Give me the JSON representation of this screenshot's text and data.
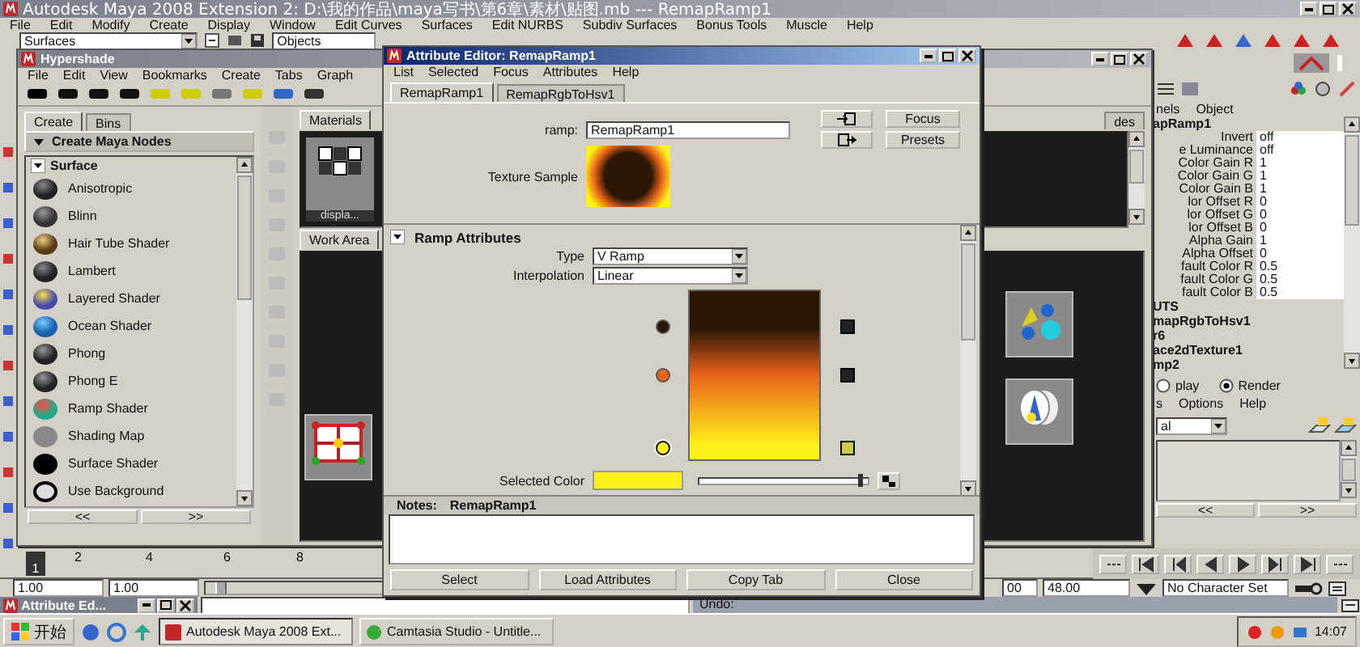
{
  "main_window": {
    "title": "Autodesk Maya 2008 Extension 2: D:\\我的作品\\maya写书\\第6章\\素材\\贴图.mb  ---  RemapRamp1",
    "menu": [
      "File",
      "Edit",
      "Modify",
      "Create",
      "Display",
      "Window",
      "Edit Curves",
      "Surfaces",
      "Edit NURBS",
      "Subdiv Surfaces",
      "Bonus Tools",
      "Muscle",
      "Help"
    ],
    "menu_set": "Surfaces",
    "select_mode": "Objects"
  },
  "hypershade": {
    "title": "Hypershade",
    "menu": [
      "File",
      "Edit",
      "View",
      "Bookmarks",
      "Create",
      "Tabs",
      "Graph"
    ],
    "create_tabs": [
      {
        "label": "Create",
        "selected": true
      },
      {
        "label": "Bins",
        "selected": false
      }
    ],
    "create_header": "Create Maya Nodes",
    "category": {
      "label": "Surface",
      "expanded": true
    },
    "nodes": [
      "Anisotropic",
      "Blinn",
      "Hair Tube Shader",
      "Lambert",
      "Layered Shader",
      "Ocean Shader",
      "Phong",
      "Phong E",
      "Ramp Shader",
      "Shading Map",
      "Surface Shader",
      "Use Background"
    ],
    "list_nav": [
      "<<",
      ">>"
    ],
    "top_tabs": [
      {
        "label": "Materials",
        "selected": true
      },
      {
        "label": "des",
        "selected": false
      }
    ],
    "material_swatch_label": "displa...",
    "work_tab": "Work Area"
  },
  "attribute_editor": {
    "title": "Attribute Editor: RemapRamp1",
    "menu": [
      "List",
      "Selected",
      "Focus",
      "Attributes",
      "Help"
    ],
    "tabs": [
      {
        "label": "RemapRamp1",
        "selected": true
      },
      {
        "label": "RemapRgbToHsv1",
        "selected": false
      }
    ],
    "node_label": "ramp:",
    "node_name": "RemapRamp1",
    "side_buttons": [
      "Focus",
      "Presets"
    ],
    "sample_label": "Texture Sample",
    "section": {
      "label": "Ramp Attributes",
      "expanded": true
    },
    "fields": [
      {
        "label": "Type",
        "value": "V Ramp"
      },
      {
        "label": "Interpolation",
        "value": "Linear"
      }
    ],
    "ramp": [
      {
        "color": "#2a1606",
        "selected": false
      },
      {
        "color": "#e8641a",
        "selected": false
      },
      {
        "color": "#fff21a",
        "selected": true
      }
    ],
    "selected_color": {
      "label": "Selected Color",
      "level": 0.97
    },
    "notes_label": "Notes:",
    "notes_node": "RemapRamp1",
    "buttons": [
      "Select",
      "Load Attributes",
      "Copy Tab",
      "Close"
    ]
  },
  "channel_box": {
    "tabs": [
      "nels",
      "Object"
    ],
    "node": "apRamp1",
    "channels": [
      {
        "label": "Invert",
        "value": "off"
      },
      {
        "label": "e Luminance",
        "value": "off"
      },
      {
        "label": "Color Gain R",
        "value": "1"
      },
      {
        "label": "Color Gain G",
        "value": "1"
      },
      {
        "label": "Color Gain B",
        "value": "1"
      },
      {
        "label": "lor Offset R",
        "value": "0"
      },
      {
        "label": "lor Offset G",
        "value": "0"
      },
      {
        "label": "lor Offset B",
        "value": "0"
      },
      {
        "label": "Alpha Gain",
        "value": "1"
      },
      {
        "label": "Alpha Offset",
        "value": "0"
      },
      {
        "label": "fault Color R",
        "value": "0.5"
      },
      {
        "label": "fault Color G",
        "value": "0.5"
      },
      {
        "label": "fault Color B",
        "value": "0.5"
      }
    ],
    "inputs": [
      "UTS",
      "mapRgbToHsv1",
      "r6",
      "ace2dTexture1",
      "mp2"
    ],
    "layer_modes": [
      {
        "label": "play",
        "selected": false
      },
      {
        "label": "Render",
        "selected": true
      }
    ],
    "layer_menu": [
      "s",
      "Options",
      "Help"
    ],
    "layer_type": "al",
    "nav": [
      "<<",
      ">>"
    ]
  },
  "timeline": {
    "current": "1",
    "ticks": [
      "2",
      "4",
      "6",
      "8"
    ]
  },
  "range": {
    "start": "1.00",
    "start_playback": "1.00",
    "level": 0.05,
    "end_cut": "00",
    "end": "48.00",
    "character_set": "No Character Set"
  },
  "command_line": {
    "minimized_window": "Attribute Ed...",
    "help": "Undo:"
  },
  "taskbar": {
    "start": "开始",
    "tasks": [
      {
        "label": "Autodesk Maya 2008 Ext...",
        "selected": true
      },
      {
        "label": "Camtasia Studio - Untitle...",
        "selected": false
      }
    ],
    "clock": "14:07"
  }
}
